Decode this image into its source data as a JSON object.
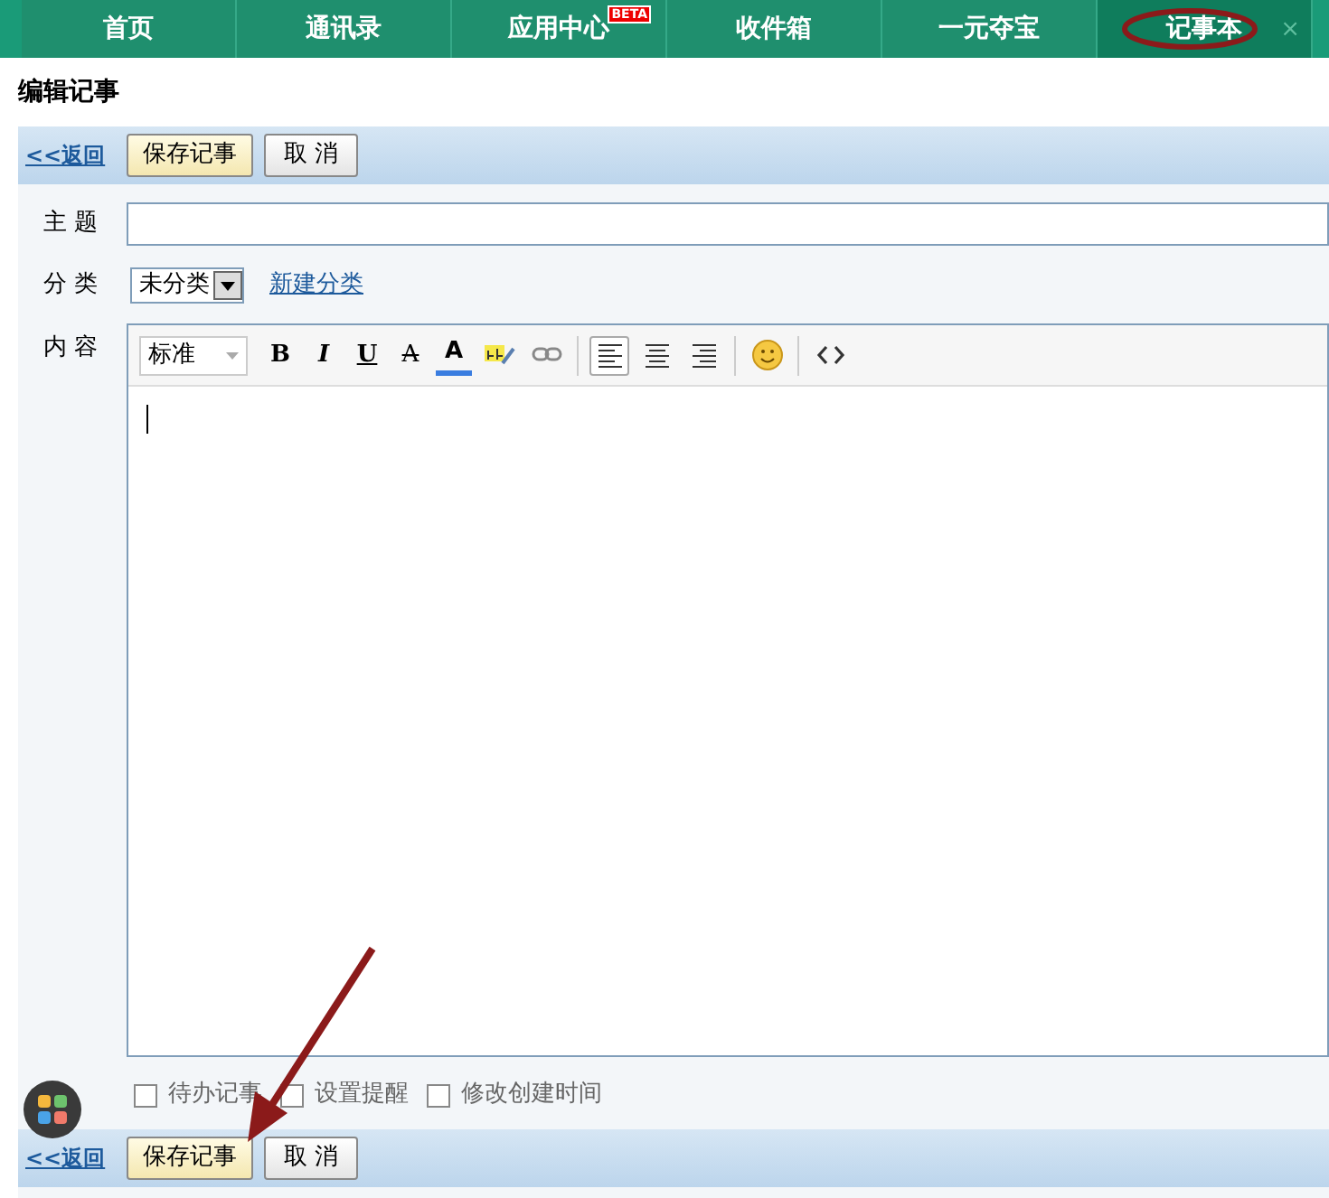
{
  "tabs": [
    {
      "label": "首页",
      "selected": false
    },
    {
      "label": "通讯录",
      "selected": false
    },
    {
      "label": "应用中心",
      "selected": false,
      "badge": "BETA"
    },
    {
      "label": "收件箱",
      "selected": false
    },
    {
      "label": "一元夺宝",
      "selected": false
    },
    {
      "label": "记事本",
      "selected": true,
      "close": "×"
    }
  ],
  "page_title": "编辑记事",
  "top_toolbar": {
    "back": "<<返回",
    "save": "保存记事",
    "cancel": "取 消"
  },
  "form": {
    "subject_label": "主 题",
    "category_label": "分 类",
    "category_value": "未分类",
    "new_category": "新建分类",
    "content_label": "内 容"
  },
  "editor_tools": [
    {
      "kind": "select",
      "label": "标准"
    },
    {
      "kind": "bold",
      "label": "B"
    },
    {
      "kind": "italic",
      "label": "I"
    },
    {
      "kind": "underline",
      "label": "U"
    },
    {
      "kind": "strike",
      "label": "A"
    },
    {
      "kind": "color",
      "label": "A"
    },
    {
      "kind": "highlight"
    },
    {
      "kind": "link"
    },
    {
      "kind": "sep"
    },
    {
      "kind": "align-left",
      "selected": true
    },
    {
      "kind": "align-center",
      "selected": false
    },
    {
      "kind": "align-right",
      "selected": false
    },
    {
      "kind": "sep"
    },
    {
      "kind": "emoji"
    },
    {
      "kind": "sep"
    },
    {
      "kind": "code"
    }
  ],
  "options": [
    {
      "label": "待办记事",
      "checked": false
    },
    {
      "label": "设置提醒",
      "checked": false
    },
    {
      "label": "修改创建时间",
      "checked": false
    }
  ],
  "bottom_toolbar": {
    "back": "<<返回",
    "save": "保存记事",
    "cancel": "取 消"
  }
}
